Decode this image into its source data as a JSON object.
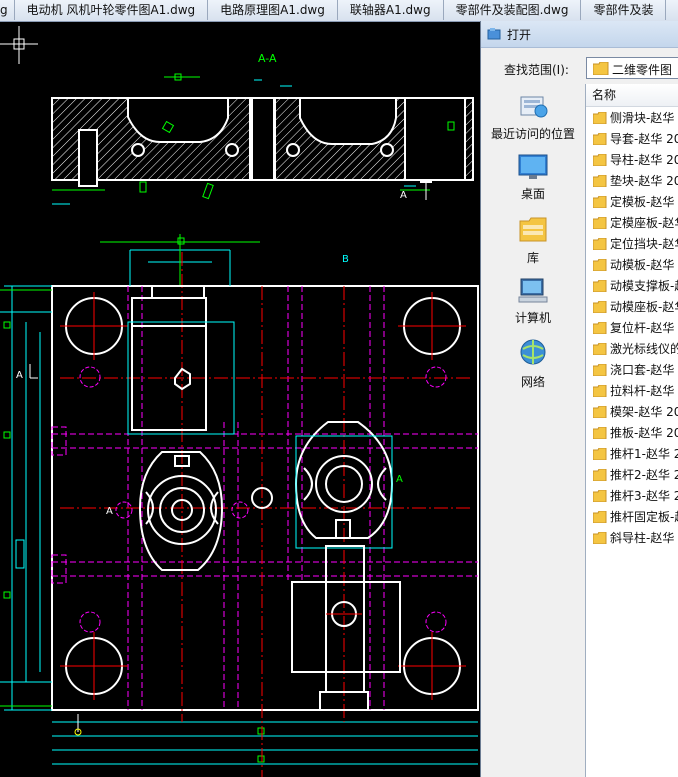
{
  "tabs": [
    {
      "label": "g"
    },
    {
      "label": "电动机 风机叶轮零件图A1.dwg"
    },
    {
      "label": "电路原理图A1.dwg"
    },
    {
      "label": "联轴器A1.dwg"
    },
    {
      "label": "零部件及装配图.dwg"
    },
    {
      "label": "零部件及装"
    }
  ],
  "drawing": {
    "section_label": "A-A",
    "marker_a": "A",
    "marker_b": "B"
  },
  "dialog": {
    "title": "打开",
    "lookin_label": "查找范围(I):",
    "lookin_value": "二维零件图",
    "column_name": "名称",
    "places": [
      {
        "label": "最近访问的位置",
        "icon": "recent-places-icon"
      },
      {
        "label": "桌面",
        "icon": "desktop-icon"
      },
      {
        "label": "库",
        "icon": "libraries-icon"
      },
      {
        "label": "计算机",
        "icon": "computer-icon"
      },
      {
        "label": "网络",
        "icon": "network-icon"
      }
    ],
    "files": [
      {
        "name": "侧滑块-赵华"
      },
      {
        "name": "导套-赵华 20"
      },
      {
        "name": "导柱-赵华 20"
      },
      {
        "name": "垫块-赵华 20"
      },
      {
        "name": "定模板-赵华"
      },
      {
        "name": "定模座板-赵华"
      },
      {
        "name": "定位挡块-赵华"
      },
      {
        "name": "动模板-赵华"
      },
      {
        "name": "动模支撑板-赵"
      },
      {
        "name": "动模座板-赵华"
      },
      {
        "name": "复位杆-赵华"
      },
      {
        "name": "激光标线仪的"
      },
      {
        "name": "浇口套-赵华"
      },
      {
        "name": "拉料杆-赵华"
      },
      {
        "name": "模架-赵华 20"
      },
      {
        "name": "推板-赵华 20"
      },
      {
        "name": "推杆1-赵华 2"
      },
      {
        "name": "推杆2-赵华 2"
      },
      {
        "name": "推杆3-赵华 2"
      },
      {
        "name": "推杆固定板-赵"
      },
      {
        "name": "斜导柱-赵华"
      }
    ]
  },
  "colors": {
    "cad_background": "#000000",
    "outline": "#ffffff",
    "cyan": "#00ffff",
    "green": "#00ff00",
    "magenta": "#ff00ff",
    "red": "#ff0000",
    "folder": "#f4c542"
  }
}
